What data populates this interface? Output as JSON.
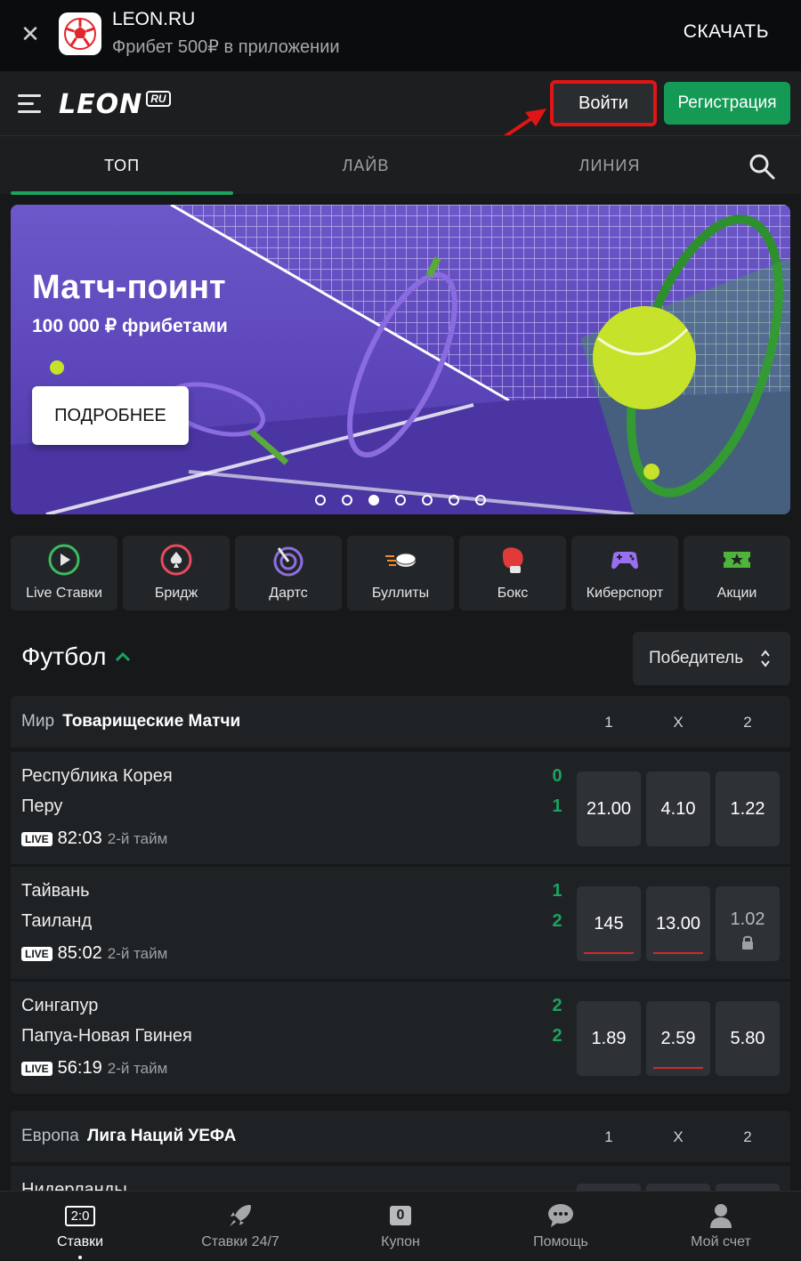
{
  "promo": {
    "title": "LEON.RU",
    "subtitle": "Фрибет 500₽ в приложении",
    "download_label": "СКАЧАТЬ"
  },
  "header": {
    "logo": "LEON",
    "logo_badge": "RU",
    "login_label": "Войти",
    "register_label": "Регистрация"
  },
  "tabs": [
    {
      "label": "ТОП",
      "active": true
    },
    {
      "label": "ЛАЙВ",
      "active": false
    },
    {
      "label": "ЛИНИЯ",
      "active": false
    }
  ],
  "banner": {
    "title": "Матч-поинт",
    "subtitle": "100 000 ₽ фрибетами",
    "button_label": "ПОДРОБНЕЕ",
    "slide_count": 7,
    "active_slide": 3
  },
  "categories": [
    {
      "label": "Live Ставки",
      "icon": "live-play-icon"
    },
    {
      "label": "Бридж",
      "icon": "bridge-spade-icon"
    },
    {
      "label": "Дартс",
      "icon": "darts-icon"
    },
    {
      "label": "Буллиты",
      "icon": "puck-icon"
    },
    {
      "label": "Бокс",
      "icon": "boxing-glove-icon"
    },
    {
      "label": "Киберспорт",
      "icon": "gamepad-icon"
    },
    {
      "label": "Акции",
      "icon": "ticket-star-icon"
    }
  ],
  "section": {
    "title": "Футбол",
    "market_label": "Победитель"
  },
  "league1": {
    "region": "Мир",
    "name": "Товарищеские Матчи",
    "cols": [
      "1",
      "X",
      "2"
    ]
  },
  "matches": [
    {
      "team1": "Республика Корея",
      "team2": "Перу",
      "score1": "0",
      "score2": "1",
      "live": "LIVE",
      "time": "82:03",
      "half": "2-й тайм",
      "odds": [
        "21.00",
        "4.10",
        "1.22"
      ]
    },
    {
      "team1": "Тайвань",
      "team2": "Таиланд",
      "score1": "1",
      "score2": "2",
      "live": "LIVE",
      "time": "85:02",
      "half": "2-й тайм",
      "odds": [
        "145",
        "13.00",
        "1.02"
      ]
    },
    {
      "team1": "Сингапур",
      "team2": "Папуа-Новая Гвинея",
      "score1": "2",
      "score2": "2",
      "live": "LIVE",
      "time": "56:19",
      "half": "2-й тайм",
      "odds": [
        "1.89",
        "2.59",
        "5.80"
      ]
    }
  ],
  "league2": {
    "region": "Европа",
    "name": "Лига Наций УЕФА",
    "cols": [
      "1",
      "X",
      "2"
    ],
    "first_team_partial": "Нидерланды"
  },
  "bottom_nav": [
    {
      "label": "Ставки",
      "badge": "2:0",
      "active": true
    },
    {
      "label": "Ставки 24/7",
      "icon": "rocket-icon"
    },
    {
      "label": "Купон",
      "badge": "0"
    },
    {
      "label": "Помощь",
      "icon": "chat-icon"
    },
    {
      "label": "Мой счет",
      "icon": "user-icon"
    }
  ],
  "colors": {
    "accent_green": "#1aa35e",
    "register_green": "#159a56",
    "annotation_red": "#e01515",
    "background": "#161819"
  }
}
